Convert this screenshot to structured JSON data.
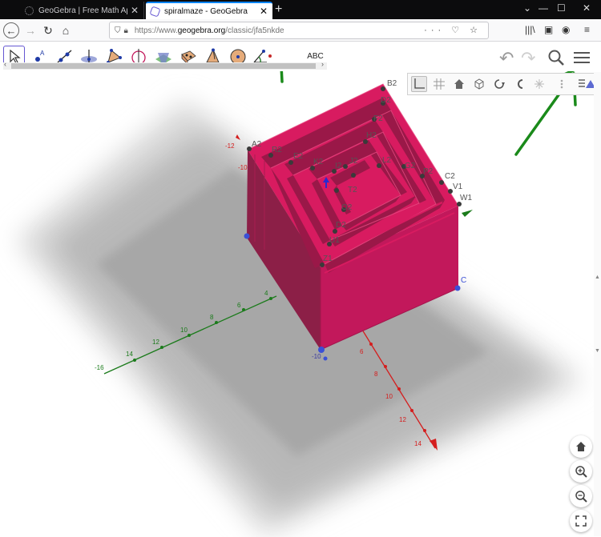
{
  "browser": {
    "tabs": [
      {
        "label": "GeoGebra | Free Math Apps - u",
        "active": false
      },
      {
        "label": "spiralmaze - GeoGebra",
        "active": true
      }
    ],
    "new_tab": "+",
    "url": {
      "prefix": "https://www.",
      "domain": "geogebra.org",
      "path": "/classic/jfa5nkde"
    },
    "url_actions": "··· ♡ ☆",
    "window_controls": {
      "minimize": "—",
      "maximize": "☐",
      "close": "✕"
    }
  },
  "toolbar": {
    "text_tool": "ABC",
    "undo": "↶",
    "redo": "↷"
  },
  "scene": {
    "accent": "#c2185b",
    "point_labels": {
      "B2": "B2",
      "D2": "D2",
      "F2": "F2",
      "H2": "H2",
      "A2": "A2",
      "R2": "R2",
      "E2": "E2",
      "K2": "K2",
      "I2": "I2",
      "J2": "J2",
      "L2": "L2",
      "G2": "G2",
      "P2": "P2",
      "C2": "C2",
      "V1": "V1",
      "W1": "W1",
      "T2": "T2",
      "O2": "O2",
      "D1": "D2",
      "U1": "U1",
      "Z1": "Z1",
      "C": "C"
    },
    "axis_ticks": {
      "y": [
        "-16",
        "14",
        "12",
        "10",
        "8",
        "6",
        "4"
      ],
      "x": [
        "6",
        "8",
        "10",
        "12",
        "14"
      ],
      "z": [
        "-12",
        "-10",
        "-10"
      ]
    }
  }
}
